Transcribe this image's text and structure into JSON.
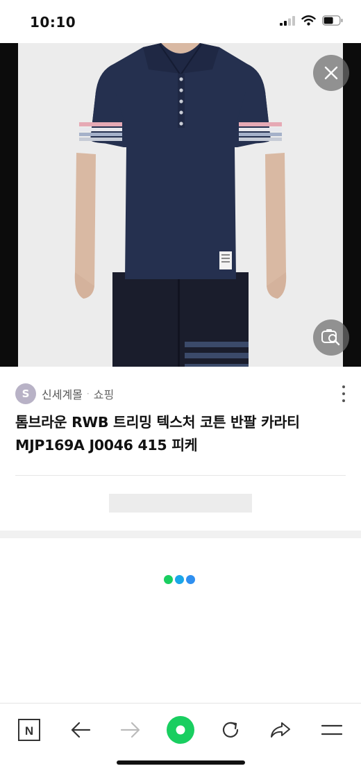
{
  "status_bar": {
    "time": "10:10",
    "battery_level": 0.6
  },
  "icons": {
    "signal": "signal-bars-icon",
    "wifi": "wifi-icon",
    "battery": "battery-icon",
    "close": "close-icon",
    "lens": "image-search-lens-icon",
    "n_home": "naver-n-home-icon",
    "back": "arrow-left-icon",
    "forward": "arrow-right-icon",
    "green_dot": "green-dot-icon",
    "reload": "reload-icon",
    "share": "share-icon",
    "menu": "hamburger-menu-icon",
    "more": "more-vertical-icon"
  },
  "source": {
    "avatar_letter": "S",
    "name": "신세계몰",
    "separator": "·",
    "category": "쇼핑"
  },
  "product": {
    "title_line1": "톰브라운 RWB 트리밍 텍스처 코튼 반팔 카라티",
    "title_line2": "MJP169A J0046 415 피케"
  },
  "toolbar": {
    "n_label": "N"
  },
  "colors": {
    "accent_green": "#19ce60",
    "dot_blue": "#1aa6e8",
    "dot_light_blue": "#2fbfe6",
    "shirt_navy": "#25304f"
  }
}
